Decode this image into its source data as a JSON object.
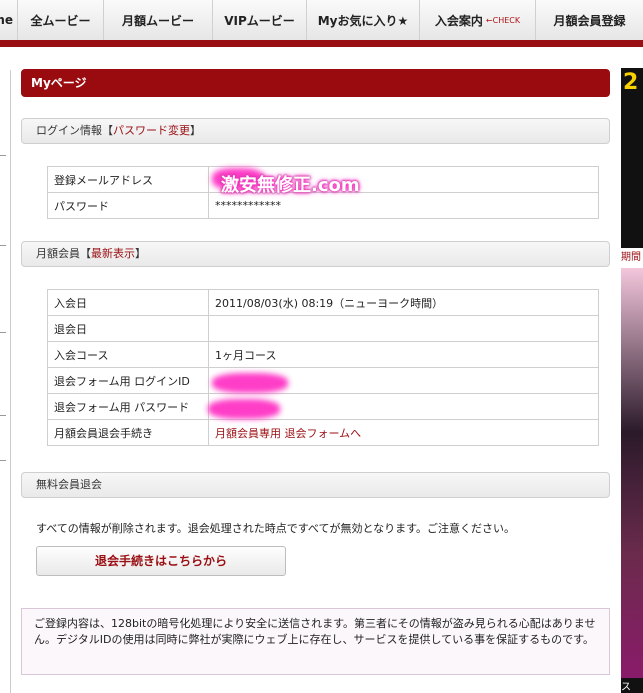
{
  "nav": {
    "items": [
      "me",
      "全ムービー",
      "月額ムービー",
      "VIPムービー",
      "Myお気に入り★",
      "入会案内",
      "月額会員登録"
    ],
    "check_label": "←CHECK"
  },
  "page_title": "Myページ",
  "login_section": {
    "heading": "ログイン情報",
    "bracket_open": "【",
    "link": "パスワード変更",
    "bracket_close": "】",
    "rows": [
      {
        "label": "登録メールアドレス",
        "value": ""
      },
      {
        "label": "パスワード",
        "value": "************"
      }
    ],
    "watermark": "激安無修正.com"
  },
  "monthly_section": {
    "heading": "月額会員",
    "bracket_open": "【",
    "link": "最新表示",
    "bracket_close": "】",
    "rows": [
      {
        "label": "入会日",
        "value": "2011/08/03(水) 08:19（ニューヨーク時間）"
      },
      {
        "label": "退会日",
        "value": ""
      },
      {
        "label": "入会コース",
        "value": "1ヶ月コース"
      },
      {
        "label": "退会フォーム用 ログインID",
        "value": ""
      },
      {
        "label": "退会フォーム用 パスワード",
        "value": ""
      },
      {
        "label": "月額会員退会手続き",
        "value": "月額会員専用 退会フォームへ"
      }
    ]
  },
  "free_section": {
    "heading": "無料会員退会",
    "notice": "すべての情報が削除されます。退会処理された時点ですべてが無効となります。ご注意ください。",
    "button": "退会手続きはこちらから"
  },
  "secure_notice": "ご登録内容は、128bitの暗号化処理により安全に送信されます。第三者にその情報が盗み見られる心配はありません。デジタルIDの使用は同時に弊社が実際にウェブ上に存在し、サービスを提供している事を保証するものです。",
  "ad": {
    "text1": "2",
    "text2": "期間",
    "text3": "ス"
  },
  "colors": {
    "accent": "#9a0f13",
    "redaction": "#ff3ec8"
  }
}
